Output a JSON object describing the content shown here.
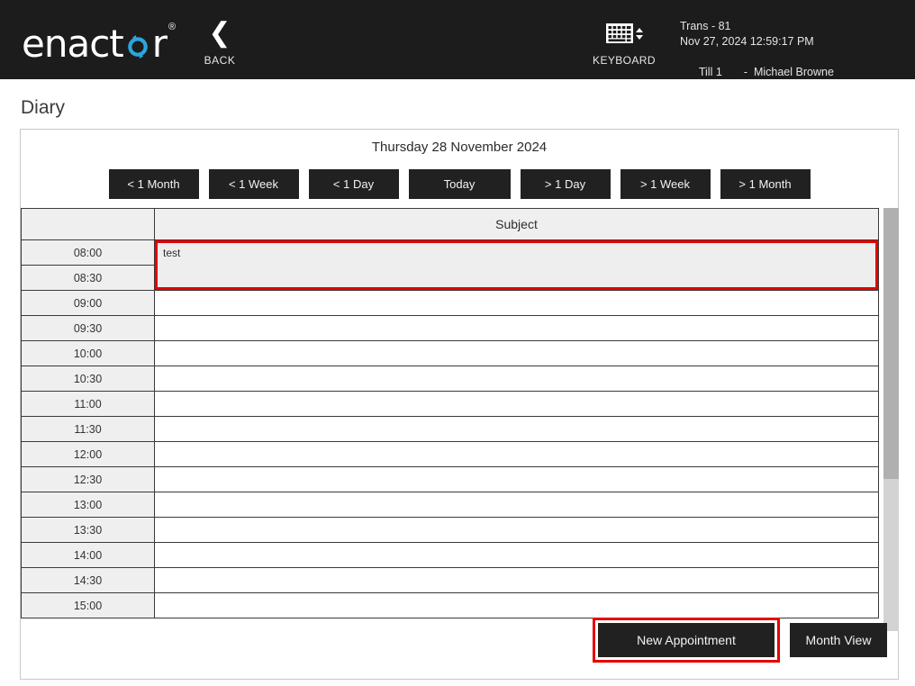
{
  "header": {
    "logo_text_part1": "enact",
    "logo_text_part2": "r",
    "logo_o_icon": "circular-arrows-icon",
    "logo_trademark": "®",
    "back_label": "BACK",
    "back_icon": "chevron-left-icon",
    "keyboard_label": "KEYBOARD",
    "keyboard_icon": "keyboard-icon",
    "session": {
      "trans": "Trans - 81",
      "datetime": "Nov 27, 2024 12:59:17 PM",
      "till": "Till 1",
      "separator": "-",
      "operator": "Michael Browne"
    },
    "bg_color": "#1c1c1c"
  },
  "page": {
    "title": "Diary"
  },
  "diary": {
    "date_heading": "Thursday 28 November 2024",
    "nav_buttons": [
      {
        "label": "< 1 Month",
        "name": "prev-month-button",
        "wide": false
      },
      {
        "label": "< 1 Week",
        "name": "prev-week-button",
        "wide": false
      },
      {
        "label": "< 1 Day",
        "name": "prev-day-button",
        "wide": false
      },
      {
        "label": "Today",
        "name": "today-button",
        "wide": true
      },
      {
        "label": "> 1 Day",
        "name": "next-day-button",
        "wide": false
      },
      {
        "label": "> 1 Week",
        "name": "next-week-button",
        "wide": false
      },
      {
        "label": "> 1 Month",
        "name": "next-month-button",
        "wide": false
      }
    ],
    "columns": {
      "time": "",
      "subject": "Subject"
    },
    "rows": [
      {
        "time": "08:00",
        "subject": "test",
        "appointment": true,
        "appointment_span": 2,
        "selected": true
      },
      {
        "time": "08:30",
        "subject": "",
        "appointment": false,
        "covered": true
      },
      {
        "time": "09:00",
        "subject": "",
        "appointment": false
      },
      {
        "time": "09:30",
        "subject": "",
        "appointment": false
      },
      {
        "time": "10:00",
        "subject": "",
        "appointment": false
      },
      {
        "time": "10:30",
        "subject": "",
        "appointment": false
      },
      {
        "time": "11:00",
        "subject": "",
        "appointment": false
      },
      {
        "time": "11:30",
        "subject": "",
        "appointment": false
      },
      {
        "time": "12:00",
        "subject": "",
        "appointment": false
      },
      {
        "time": "12:30",
        "subject": "",
        "appointment": false
      },
      {
        "time": "13:00",
        "subject": "",
        "appointment": false
      },
      {
        "time": "13:30",
        "subject": "",
        "appointment": false
      },
      {
        "time": "14:00",
        "subject": "",
        "appointment": false
      },
      {
        "time": "14:30",
        "subject": "",
        "appointment": false
      },
      {
        "time": "15:00",
        "subject": "",
        "appointment": false
      }
    ],
    "scrollbar": {
      "thumb_top_pct": 0,
      "thumb_height_pct": 64
    }
  },
  "footer": {
    "new_appointment_label": "New Appointment",
    "month_view_label": "Month View",
    "selected_button": "new-appointment-button"
  },
  "colors": {
    "accent_red": "#e60000",
    "dark": "#212121",
    "header_bg": "#1c1c1c",
    "row_alt": "#efefef",
    "brand_blue": "#2ba6de"
  }
}
